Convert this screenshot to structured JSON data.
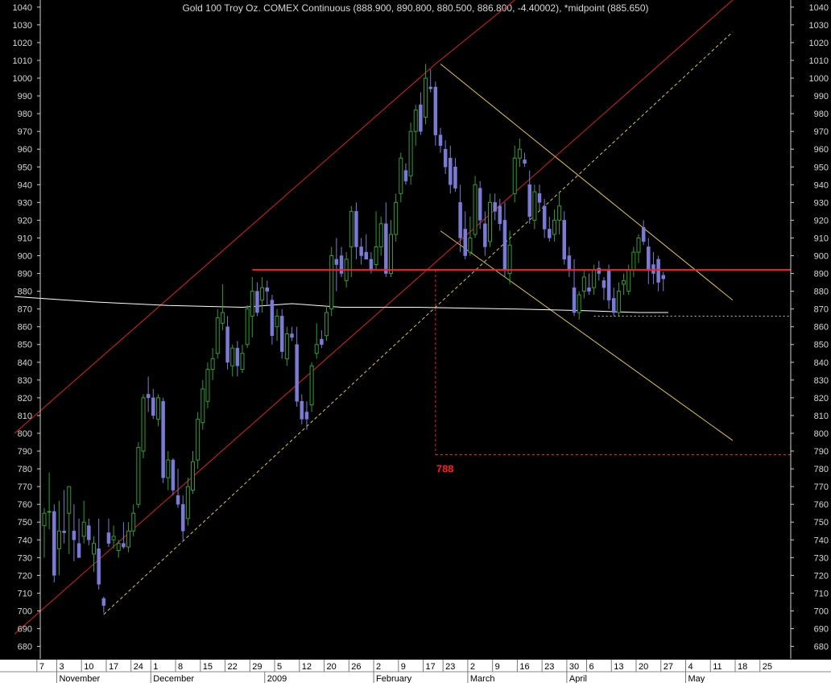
{
  "chart_data": {
    "type": "candlestick",
    "title": "Gold 100 Troy Oz. COMEX Continuous (888.900, 890.800, 880.500, 886.800, -4.40002), *midpoint (885.650)",
    "ylim": [
      673,
      1044
    ],
    "yticks": [
      680,
      690,
      700,
      710,
      720,
      730,
      740,
      750,
      760,
      770,
      780,
      790,
      800,
      810,
      820,
      830,
      840,
      850,
      860,
      870,
      880,
      890,
      900,
      910,
      920,
      930,
      940,
      950,
      960,
      970,
      980,
      990,
      1000,
      1010,
      1020,
      1030,
      1040
    ],
    "day_labels": [
      "7",
      "3",
      "10",
      "17",
      "24",
      "1",
      "8",
      "15",
      "22",
      "29",
      "5",
      "12",
      "20",
      "26",
      "2",
      "9",
      "17",
      "23",
      "2",
      "9",
      "16",
      "23",
      "30",
      "6",
      "13",
      "20",
      "27",
      "4",
      "11",
      "18",
      "25"
    ],
    "month_labels": [
      "November",
      "December",
      "2009",
      "February",
      "March",
      "April",
      "May"
    ],
    "annotations": [
      {
        "text": "788",
        "color": "#ff1a1a"
      }
    ],
    "horizontal_line": {
      "value": 892,
      "color": "#ff2020"
    },
    "target_box": {
      "top": 892,
      "bottom": 788,
      "color": "#ff2020"
    },
    "support_dashed": {
      "value": 866,
      "color": "#bbbbbb"
    },
    "colors": {
      "up": "#2e9e2e",
      "down": "#7b7bd6",
      "red_channel": "#e02020",
      "yellow_channel": "#e0c640",
      "moving_average": "#ffffff",
      "axis_text": "#d8d8d8"
    },
    "candles": [
      {
        "o": 748,
        "h": 758,
        "l": 730,
        "c": 755
      },
      {
        "o": 756,
        "h": 778,
        "l": 746,
        "c": 756
      },
      {
        "o": 756,
        "h": 760,
        "l": 716,
        "c": 720
      },
      {
        "o": 735,
        "h": 762,
        "l": 720,
        "c": 745
      },
      {
        "o": 745,
        "h": 768,
        "l": 738,
        "c": 744
      },
      {
        "o": 755,
        "h": 770,
        "l": 732,
        "c": 770
      },
      {
        "o": 745,
        "h": 760,
        "l": 728,
        "c": 740
      },
      {
        "o": 738,
        "h": 752,
        "l": 730,
        "c": 730
      },
      {
        "o": 742,
        "h": 762,
        "l": 738,
        "c": 750
      },
      {
        "o": 748,
        "h": 752,
        "l": 737,
        "c": 740
      },
      {
        "o": 732,
        "h": 742,
        "l": 722,
        "c": 738
      },
      {
        "o": 735,
        "h": 752,
        "l": 712,
        "c": 715
      },
      {
        "o": 707,
        "h": 708,
        "l": 699,
        "c": 703
      },
      {
        "o": 744,
        "h": 752,
        "l": 736,
        "c": 738
      },
      {
        "o": 740,
        "h": 748,
        "l": 735,
        "c": 742
      },
      {
        "o": 734,
        "h": 740,
        "l": 730,
        "c": 738
      },
      {
        "o": 738,
        "h": 750,
        "l": 735,
        "c": 736
      },
      {
        "o": 736,
        "h": 750,
        "l": 733,
        "c": 745
      },
      {
        "o": 745,
        "h": 760,
        "l": 742,
        "c": 755
      },
      {
        "o": 760,
        "h": 795,
        "l": 758,
        "c": 792
      },
      {
        "o": 790,
        "h": 822,
        "l": 786,
        "c": 820
      },
      {
        "o": 822,
        "h": 832,
        "l": 812,
        "c": 820
      },
      {
        "o": 820,
        "h": 825,
        "l": 808,
        "c": 810
      },
      {
        "o": 808,
        "h": 822,
        "l": 804,
        "c": 820
      },
      {
        "o": 818,
        "h": 820,
        "l": 772,
        "c": 775
      },
      {
        "o": 775,
        "h": 790,
        "l": 768,
        "c": 785
      },
      {
        "o": 785,
        "h": 786,
        "l": 765,
        "c": 768
      },
      {
        "o": 765,
        "h": 780,
        "l": 758,
        "c": 760
      },
      {
        "o": 760,
        "h": 765,
        "l": 740,
        "c": 745
      },
      {
        "o": 752,
        "h": 775,
        "l": 748,
        "c": 770
      },
      {
        "o": 768,
        "h": 790,
        "l": 766,
        "c": 784
      },
      {
        "o": 785,
        "h": 812,
        "l": 780,
        "c": 808
      },
      {
        "o": 806,
        "h": 830,
        "l": 802,
        "c": 825
      },
      {
        "o": 818,
        "h": 840,
        "l": 814,
        "c": 836
      },
      {
        "o": 836,
        "h": 848,
        "l": 830,
        "c": 842
      },
      {
        "o": 845,
        "h": 870,
        "l": 842,
        "c": 865
      },
      {
        "o": 862,
        "h": 884,
        "l": 858,
        "c": 868
      },
      {
        "o": 860,
        "h": 866,
        "l": 836,
        "c": 840
      },
      {
        "o": 838,
        "h": 850,
        "l": 832,
        "c": 848
      },
      {
        "o": 848,
        "h": 852,
        "l": 832,
        "c": 838
      },
      {
        "o": 836,
        "h": 850,
        "l": 834,
        "c": 845
      },
      {
        "o": 850,
        "h": 872,
        "l": 848,
        "c": 870
      },
      {
        "o": 866,
        "h": 888,
        "l": 854,
        "c": 880
      },
      {
        "o": 880,
        "h": 885,
        "l": 866,
        "c": 868
      },
      {
        "o": 875,
        "h": 888,
        "l": 868,
        "c": 882
      },
      {
        "o": 882,
        "h": 886,
        "l": 872,
        "c": 880
      },
      {
        "o": 875,
        "h": 878,
        "l": 850,
        "c": 855
      },
      {
        "o": 860,
        "h": 870,
        "l": 852,
        "c": 866
      },
      {
        "o": 866,
        "h": 870,
        "l": 842,
        "c": 846
      },
      {
        "o": 842,
        "h": 860,
        "l": 838,
        "c": 856
      },
      {
        "o": 856,
        "h": 860,
        "l": 852,
        "c": 854
      },
      {
        "o": 850,
        "h": 860,
        "l": 815,
        "c": 818
      },
      {
        "o": 818,
        "h": 822,
        "l": 805,
        "c": 808
      },
      {
        "o": 812,
        "h": 818,
        "l": 802,
        "c": 808
      },
      {
        "o": 816,
        "h": 840,
        "l": 812,
        "c": 838
      },
      {
        "o": 845,
        "h": 862,
        "l": 842,
        "c": 850
      },
      {
        "o": 853,
        "h": 858,
        "l": 848,
        "c": 850
      },
      {
        "o": 855,
        "h": 872,
        "l": 852,
        "c": 868
      },
      {
        "o": 870,
        "h": 905,
        "l": 866,
        "c": 900
      },
      {
        "o": 898,
        "h": 910,
        "l": 880,
        "c": 895
      },
      {
        "o": 900,
        "h": 905,
        "l": 888,
        "c": 890
      },
      {
        "o": 886,
        "h": 902,
        "l": 882,
        "c": 898
      },
      {
        "o": 905,
        "h": 928,
        "l": 888,
        "c": 925
      },
      {
        "o": 925,
        "h": 930,
        "l": 898,
        "c": 905
      },
      {
        "o": 905,
        "h": 910,
        "l": 895,
        "c": 900
      },
      {
        "o": 902,
        "h": 912,
        "l": 898,
        "c": 898
      },
      {
        "o": 898,
        "h": 902,
        "l": 890,
        "c": 892
      },
      {
        "o": 895,
        "h": 925,
        "l": 892,
        "c": 905
      },
      {
        "o": 905,
        "h": 922,
        "l": 900,
        "c": 918
      },
      {
        "o": 918,
        "h": 930,
        "l": 888,
        "c": 890
      },
      {
        "o": 890,
        "h": 920,
        "l": 888,
        "c": 912
      },
      {
        "o": 912,
        "h": 935,
        "l": 908,
        "c": 930
      },
      {
        "o": 935,
        "h": 958,
        "l": 930,
        "c": 955
      },
      {
        "o": 948,
        "h": 952,
        "l": 940,
        "c": 942
      },
      {
        "o": 945,
        "h": 975,
        "l": 940,
        "c": 970
      },
      {
        "o": 970,
        "h": 985,
        "l": 962,
        "c": 982
      },
      {
        "o": 985,
        "h": 992,
        "l": 968,
        "c": 970
      },
      {
        "o": 978,
        "h": 1008,
        "l": 974,
        "c": 1000
      },
      {
        "o": 995,
        "h": 1005,
        "l": 992,
        "c": 994
      },
      {
        "o": 995,
        "h": 998,
        "l": 962,
        "c": 968
      },
      {
        "o": 968,
        "h": 972,
        "l": 958,
        "c": 962
      },
      {
        "o": 960,
        "h": 965,
        "l": 946,
        "c": 950
      },
      {
        "o": 955,
        "h": 962,
        "l": 935,
        "c": 940
      },
      {
        "o": 950,
        "h": 955,
        "l": 936,
        "c": 938
      },
      {
        "o": 930,
        "h": 940,
        "l": 902,
        "c": 910
      },
      {
        "o": 915,
        "h": 925,
        "l": 898,
        "c": 900
      },
      {
        "o": 902,
        "h": 922,
        "l": 900,
        "c": 910
      },
      {
        "o": 912,
        "h": 945,
        "l": 910,
        "c": 940
      },
      {
        "o": 938,
        "h": 942,
        "l": 915,
        "c": 920
      },
      {
        "o": 918,
        "h": 925,
        "l": 900,
        "c": 905
      },
      {
        "o": 908,
        "h": 935,
        "l": 905,
        "c": 930
      },
      {
        "o": 930,
        "h": 935,
        "l": 920,
        "c": 925
      },
      {
        "o": 928,
        "h": 932,
        "l": 914,
        "c": 918
      },
      {
        "o": 920,
        "h": 930,
        "l": 888,
        "c": 892
      },
      {
        "o": 890,
        "h": 914,
        "l": 884,
        "c": 906
      },
      {
        "o": 935,
        "h": 962,
        "l": 930,
        "c": 955
      },
      {
        "o": 955,
        "h": 966,
        "l": 950,
        "c": 960
      },
      {
        "o": 954,
        "h": 958,
        "l": 950,
        "c": 952
      },
      {
        "o": 940,
        "h": 948,
        "l": 918,
        "c": 922
      },
      {
        "o": 920,
        "h": 940,
        "l": 915,
        "c": 936
      },
      {
        "o": 935,
        "h": 940,
        "l": 925,
        "c": 930
      },
      {
        "o": 928,
        "h": 932,
        "l": 910,
        "c": 915
      },
      {
        "o": 915,
        "h": 922,
        "l": 908,
        "c": 910
      },
      {
        "o": 912,
        "h": 926,
        "l": 908,
        "c": 920
      },
      {
        "o": 920,
        "h": 936,
        "l": 912,
        "c": 928
      },
      {
        "o": 920,
        "h": 925,
        "l": 895,
        "c": 898
      },
      {
        "o": 900,
        "h": 905,
        "l": 888,
        "c": 892
      },
      {
        "o": 882,
        "h": 898,
        "l": 866,
        "c": 868
      },
      {
        "o": 868,
        "h": 880,
        "l": 864,
        "c": 878
      },
      {
        "o": 880,
        "h": 892,
        "l": 876,
        "c": 888
      },
      {
        "o": 882,
        "h": 890,
        "l": 878,
        "c": 880
      },
      {
        "o": 882,
        "h": 895,
        "l": 878,
        "c": 892
      },
      {
        "o": 893,
        "h": 897,
        "l": 886,
        "c": 890
      },
      {
        "o": 886,
        "h": 888,
        "l": 875,
        "c": 882
      },
      {
        "o": 892,
        "h": 895,
        "l": 870,
        "c": 875
      },
      {
        "o": 876,
        "h": 882,
        "l": 866,
        "c": 868
      },
      {
        "o": 868,
        "h": 885,
        "l": 866,
        "c": 880
      },
      {
        "o": 884,
        "h": 890,
        "l": 878,
        "c": 886
      },
      {
        "o": 880,
        "h": 895,
        "l": 878,
        "c": 892
      },
      {
        "o": 892,
        "h": 905,
        "l": 888,
        "c": 902
      },
      {
        "o": 902,
        "h": 912,
        "l": 896,
        "c": 910
      },
      {
        "o": 916,
        "h": 920,
        "l": 906,
        "c": 908
      },
      {
        "o": 905,
        "h": 910,
        "l": 884,
        "c": 892
      },
      {
        "o": 895,
        "h": 902,
        "l": 884,
        "c": 890
      },
      {
        "o": 898,
        "h": 900,
        "l": 880,
        "c": 885
      },
      {
        "o": 889,
        "h": 891,
        "l": 880,
        "c": 887
      }
    ],
    "moving_average": [
      {
        "i": -6,
        "v": 877
      },
      {
        "i": 10,
        "v": 874
      },
      {
        "i": 25,
        "v": 872
      },
      {
        "i": 40,
        "v": 871
      },
      {
        "i": 50,
        "v": 873
      },
      {
        "i": 60,
        "v": 871
      },
      {
        "i": 75,
        "v": 871
      },
      {
        "i": 95,
        "v": 870
      },
      {
        "i": 110,
        "v": 869
      },
      {
        "i": 120,
        "v": 868
      },
      {
        "i": 126,
        "v": 868
      }
    ],
    "trend_lines": [
      {
        "name": "upper-red-channel",
        "color": "#e02020",
        "dash": false,
        "p1": {
          "i": -6,
          "v": 800
        },
        "p2": {
          "i": 79,
          "v": 1008
        }
      },
      {
        "name": "upper-red-ext",
        "color": "#e02020",
        "dash": false,
        "p1": {
          "i": 79,
          "v": 1008
        },
        "p2": {
          "i": 95,
          "v": 1044
        }
      },
      {
        "name": "lower-red-channel",
        "color": "#e02020",
        "dash": false,
        "p1": {
          "i": -6,
          "v": 687
        },
        "p2": {
          "i": 139,
          "v": 1044
        }
      },
      {
        "name": "dashed-parallel",
        "color": "#e0c640",
        "dash": true,
        "p1": {
          "i": 12,
          "v": 698
        },
        "p2": {
          "i": 139,
          "v": 1026
        }
      },
      {
        "name": "yellow-upper",
        "color": "#e0c640",
        "dash": false,
        "p1": {
          "i": 80,
          "v": 1008
        },
        "p2": {
          "i": 139,
          "v": 875
        }
      },
      {
        "name": "yellow-lower",
        "color": "#e0c640",
        "dash": false,
        "p1": {
          "i": 80,
          "v": 914
        },
        "p2": {
          "i": 139,
          "v": 796
        }
      }
    ]
  }
}
